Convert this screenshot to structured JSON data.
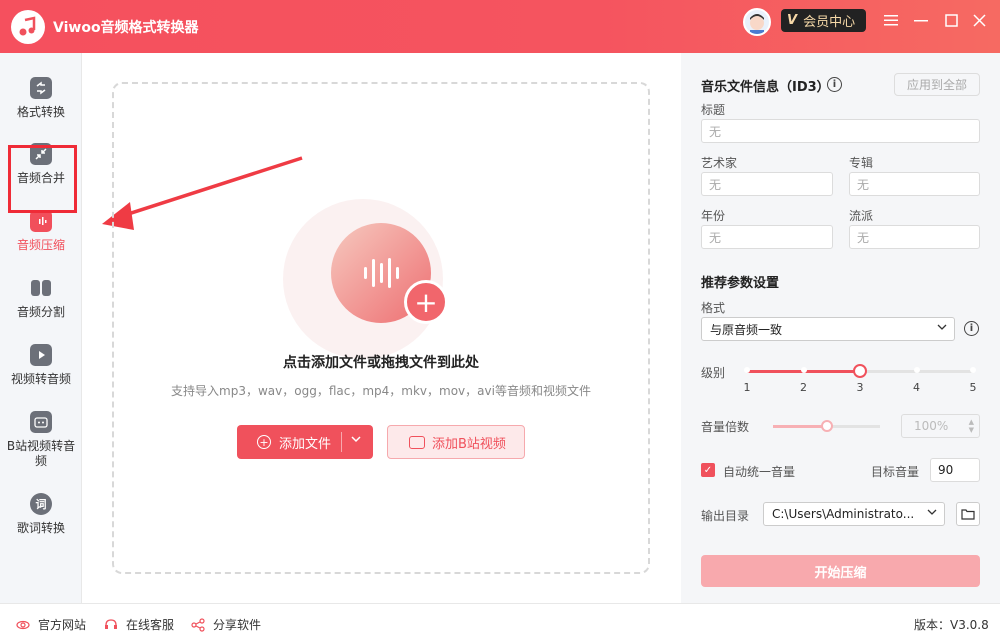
{
  "app": {
    "title": "Viwoo音频格式转换器"
  },
  "header": {
    "vip_label": "会员中心",
    "vip_badge": "V"
  },
  "sidebar": {
    "items": [
      {
        "label": "格式转换",
        "icon": "format-convert-icon"
      },
      {
        "label": "音频合并",
        "icon": "merge-icon"
      },
      {
        "label": "音频压缩",
        "icon": "compress-icon",
        "active": true
      },
      {
        "label": "音频分割",
        "icon": "split-icon"
      },
      {
        "label": "视频转音频",
        "icon": "video-to-audio-icon"
      },
      {
        "label": "B站视频转音频",
        "icon": "bilibili-icon"
      },
      {
        "label": "歌词转换",
        "icon": "lyrics-icon",
        "glyph": "词"
      }
    ]
  },
  "dropzone": {
    "title": "点击添加文件或拖拽文件到此处",
    "subtitle": "支持导入mp3，wav，ogg，flac，mp4，mkv，mov，avi等音频和视频文件",
    "add_file_label": "添加文件",
    "add_bili_label": "添加B站视频"
  },
  "id3": {
    "heading": "音乐文件信息（ID3）",
    "apply_all": "应用到全部",
    "title_label": "标题",
    "title_value": "无",
    "artist_label": "艺术家",
    "artist_value": "无",
    "album_label": "专辑",
    "album_value": "无",
    "year_label": "年份",
    "year_value": "无",
    "genre_label": "流派",
    "genre_value": "无"
  },
  "params": {
    "heading": "推荐参数设置",
    "format_label": "格式",
    "format_value": "与原音频一致",
    "level_label": "级别",
    "level_ticks": [
      "1",
      "2",
      "3",
      "4",
      "5"
    ],
    "level_value": 3,
    "volume_label": "音量倍数",
    "volume_value": "100%",
    "volume_fraction": 0.5,
    "auto_volume_label": "自动统一音量",
    "auto_volume_checked": true,
    "target_volume_label": "目标音量",
    "target_volume_value": "90",
    "output_label": "输出目录",
    "output_value": "C:\\Users\\Administrato...",
    "start_label": "开始压缩"
  },
  "footer": {
    "website": "官方网站",
    "support": "在线客服",
    "share": "分享软件",
    "version": "版本：V3.0.8"
  },
  "colors": {
    "accent": "#f0515c",
    "sidebar_bg": "#f4f6f9",
    "panel_bg": "#f5f6f8"
  }
}
